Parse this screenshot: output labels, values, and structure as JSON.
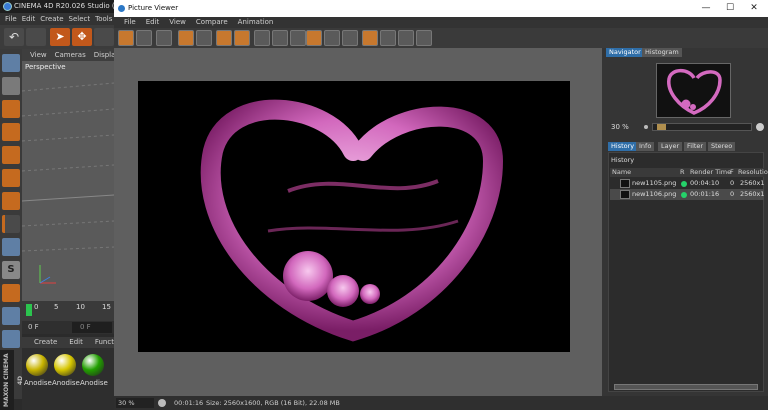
{
  "c4d": {
    "title": "CINEMA 4D R20.026 Studio (RC - R",
    "menu": [
      "File",
      "Edit",
      "Create",
      "Select",
      "Tools"
    ],
    "viewport_menu": [
      "View",
      "Cameras",
      "Display"
    ],
    "viewport_label": "Perspective",
    "timeline_ticks": [
      "0",
      "5",
      "10",
      "15"
    ],
    "frame_field": "0 F",
    "frame_field2": "0 F",
    "material_menu": [
      "Create",
      "Edit",
      "Function"
    ],
    "materials": [
      {
        "label": "Anodise",
        "color": "#c8b400"
      },
      {
        "label": "Anodise",
        "color": "#d6c600"
      },
      {
        "label": "Anodise",
        "color": "#22a000"
      }
    ],
    "brand": "MAXON CINEMA 4D"
  },
  "viewer": {
    "title": "Picture Viewer",
    "menu": [
      "File",
      "Edit",
      "View",
      "Compare",
      "Animation"
    ],
    "window_controls": [
      "—",
      "☐",
      "✕"
    ],
    "right_tabs_top": [
      "Navigator",
      "Histogram"
    ],
    "nav_zoom": "30 %",
    "right_tabs_bottom": [
      "History",
      "Info",
      "Layer",
      "Filter",
      "Stereo"
    ],
    "history_title": "History",
    "history_columns": [
      "Name",
      "R",
      "Render Time",
      "F",
      "Resolutio"
    ],
    "history_rows": [
      {
        "name": "new1105.png",
        "time": "00:04:10",
        "frame": "0",
        "res": "2560x1"
      },
      {
        "name": "new1106.png",
        "time": "00:01:16",
        "frame": "0",
        "res": "2560x1"
      }
    ],
    "status": {
      "zoom": "30 %",
      "time": "00:01:16",
      "info": "Size: 2560x1600, RGB (16 Bit), 22.08 MB"
    }
  }
}
